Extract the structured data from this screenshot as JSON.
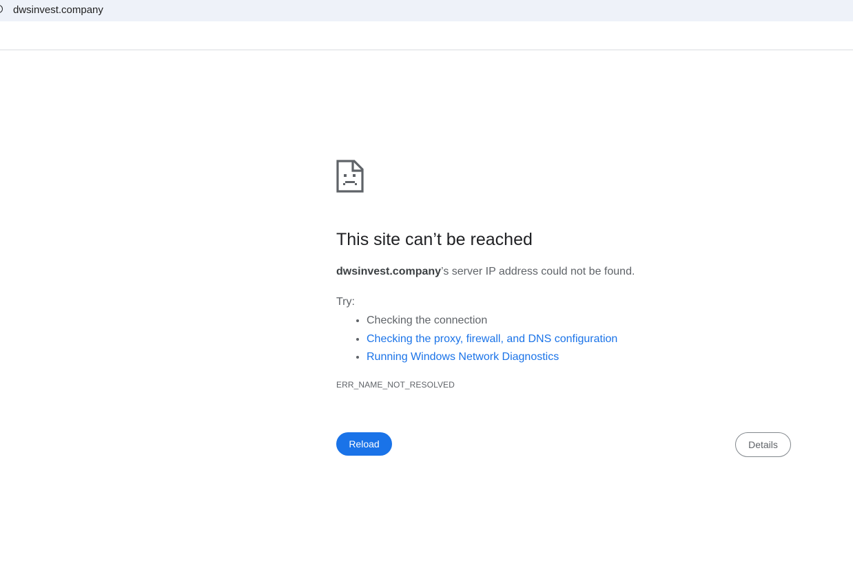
{
  "address_bar": {
    "url": "dwsinvest.company"
  },
  "error_page": {
    "icon": "sad-document-icon",
    "heading": "This site can’t be reached",
    "message": {
      "host": "dwsinvest.company",
      "suffix": "’s server IP address could not be found."
    },
    "try_label": "Try:",
    "suggestions": [
      "Checking the connection",
      "Checking the proxy, firewall, and DNS configuration",
      "Running Windows Network Diagnostics"
    ],
    "error_code": "ERR_NAME_NOT_RESOLVED",
    "reload_label": "Reload",
    "details_label": "Details"
  },
  "colors": {
    "accent": "#1a73e8",
    "text": "#5f6368",
    "heading": "#202124",
    "address_bar_bg": "#eef2f9"
  }
}
